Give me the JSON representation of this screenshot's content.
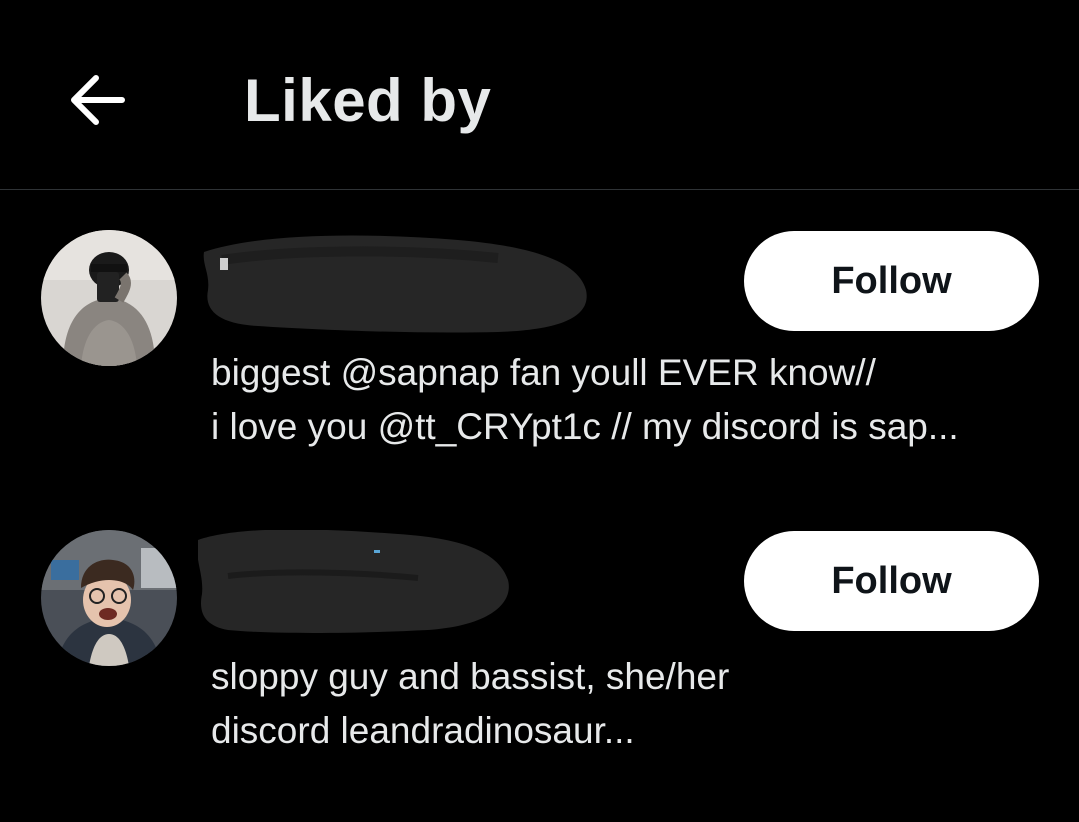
{
  "header": {
    "title": "Liked by",
    "back_icon": "arrow-left-icon"
  },
  "users": [
    {
      "avatar_icon": "user-avatar-photo",
      "follow_label": "Follow",
      "bio_lines": [
        "biggest @sapnap fan youll EVER know//",
        "i love you @tt_CRYpt1c // my discord is sap..."
      ]
    },
    {
      "avatar_icon": "user-avatar-photo",
      "follow_label": "Follow",
      "bio_lines": [
        "sloppy guy and bassist, she/her",
        "discord leandradinosaur..."
      ]
    }
  ],
  "colors": {
    "background": "#000000",
    "text": "#e7e9ea",
    "divider": "#2f3336",
    "button_bg": "#ffffff",
    "button_text": "#0f1419"
  }
}
